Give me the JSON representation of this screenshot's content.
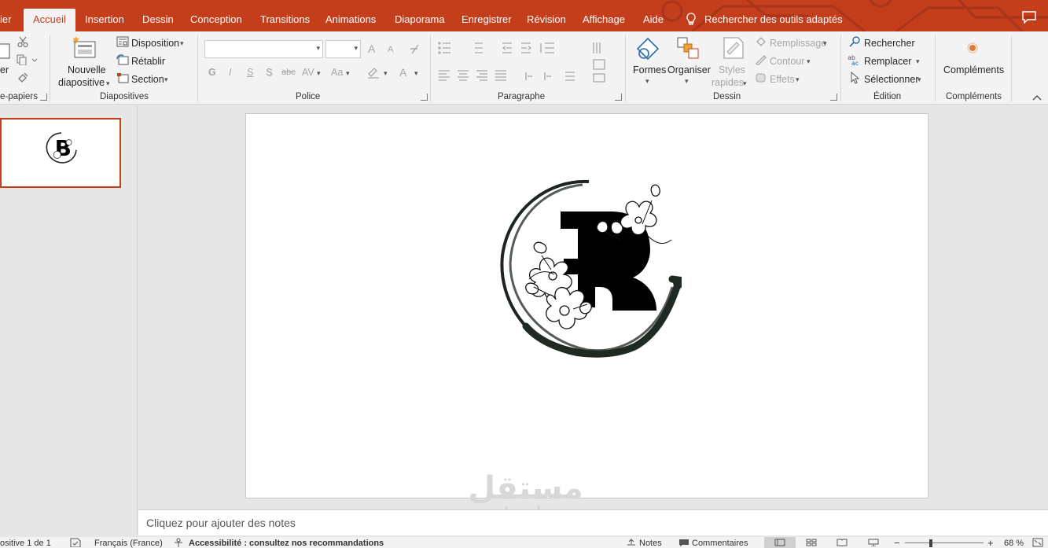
{
  "tabs": [
    {
      "label": "ier"
    },
    {
      "label": "Accueil"
    },
    {
      "label": "Insertion"
    },
    {
      "label": "Dessin"
    },
    {
      "label": "Conception"
    },
    {
      "label": "Transitions"
    },
    {
      "label": "Animations"
    },
    {
      "label": "Diaporama"
    },
    {
      "label": "Enregistrer"
    },
    {
      "label": "Révision"
    },
    {
      "label": "Affichage"
    },
    {
      "label": "Aide"
    }
  ],
  "search_label": "Rechercher des outils adaptés",
  "ribbon": {
    "clipboard": {
      "paste_fragment": "er",
      "group": "e-papiers"
    },
    "slides": {
      "new_slide_1": "Nouvelle",
      "new_slide_2": "diapositive",
      "layout": "Disposition",
      "reset": "Rétablir",
      "section": "Section",
      "group": "Diapositives"
    },
    "font": {
      "bold": "G",
      "italic": "I",
      "underline": "S",
      "shadow": "S",
      "strike": "abc",
      "spacing": "AV",
      "case": "Aa",
      "grow": "A",
      "shrink": "A",
      "color": "A",
      "group": "Police"
    },
    "paragraph": {
      "group": "Paragraphe"
    },
    "drawing": {
      "shapes": "Formes",
      "arrange": "Organiser",
      "styles_1": "Styles",
      "styles_2": "rapides",
      "fill": "Remplissage",
      "outline": "Contour",
      "effects": "Effets",
      "group": "Dessin"
    },
    "editing": {
      "find": "Rechercher",
      "replace": "Remplacer",
      "select": "Sélectionner",
      "group": "Édition"
    },
    "addins": {
      "label": "Compléments",
      "group": "Compléments"
    }
  },
  "slide": {
    "logo_letter": "B"
  },
  "notes_placeholder": "Cliquez pour ajouter des notes",
  "watermark": {
    "arabic": "مستقل",
    "latin": "mostaql.com"
  },
  "status": {
    "slide_count": "ositive 1 de 1",
    "language": "Français (France)",
    "accessibility": "Accessibilité : consultez nos recommandations",
    "notes": "Notes",
    "comments": "Commentaires",
    "zoom": "68 %"
  },
  "colors": {
    "accent": "#c43e1c",
    "ribbon": "#f3f3f3",
    "workspace": "#e6e6e6"
  }
}
